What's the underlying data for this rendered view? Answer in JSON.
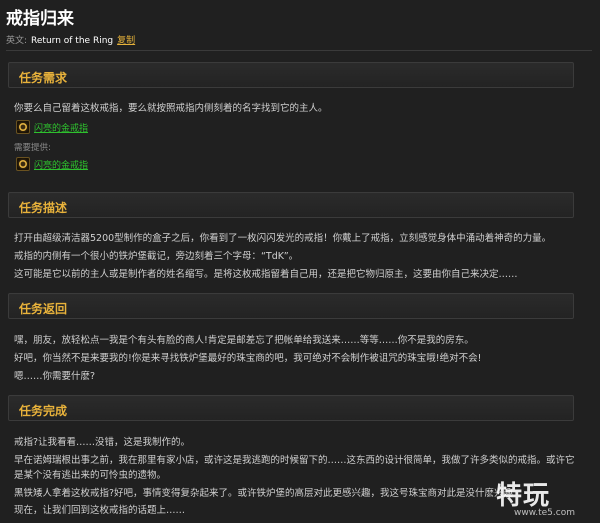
{
  "header": {
    "title": "戒指归来",
    "en_label": "英文:",
    "en_name": "Return of the Ring",
    "copy_label": "复制"
  },
  "sections": {
    "requirement": {
      "title": "任务需求",
      "text": "你要么自己留着这枚戒指，要么就按照戒指内侧刻着的名字找到它的主人。",
      "item_name": "闪亮的金戒指",
      "provided_label": "需要提供:",
      "provided_item": "闪亮的金戒指"
    },
    "description": {
      "title": "任务描述",
      "lines": [
        "打开由超级清洁器5200型制作的盒子之后，你看到了一枚闪闪发光的戒指！你戴上了戒指，立刻感觉身体中涌动着神奇的力量。",
        "戒指的内侧有一个很小的铁炉堡截记，旁边刻着三个字母：“TdK”。",
        "这可能是它以前的主人或是制作者的姓名缩写。是将这枚戒指留着自己用，还是把它物归原主，这要由你自己来决定……"
      ]
    },
    "return": {
      "title": "任务返回",
      "lines": [
        "嘿，朋友，放轻松点一我是个有头有脸的商人!肯定是邮差忘了把帐单给我送来……等等……你不是我的房东。",
        "好吧，你当然不是来要我的!你是来寻找铁炉堡最好的珠宝商的吧，我可绝对不会制作被诅咒的珠宝哦!绝对不会!",
        "嗯……你需要什麽?"
      ]
    },
    "complete": {
      "title": "任务完成",
      "lines": [
        "戒指?让我看看……没错，这是我制作的。",
        "早在诺姆瑞根出事之前，我在那里有家小店，或许这是我逃跑的时候留下的……这东西的设计很简单，我做了许多类似的戒指。或许它",
        "是某个没有逃出来的可怜虫的遗物。",
        "黑铁矮人拿着这枚戒指?好吧，事情变得复杂起来了。或许铁炉堡的高层对此更感兴趣，我这号珠宝商对此是没什麽兴趣",
        "现在，让我们回到这枚戒指的话题上……"
      ]
    }
  },
  "watermark": {
    "logo": "特玩",
    "url": "www.te5.com"
  },
  "colors": {
    "accent": "#e8b23b",
    "link": "#2ec02e",
    "background": "#202020"
  }
}
